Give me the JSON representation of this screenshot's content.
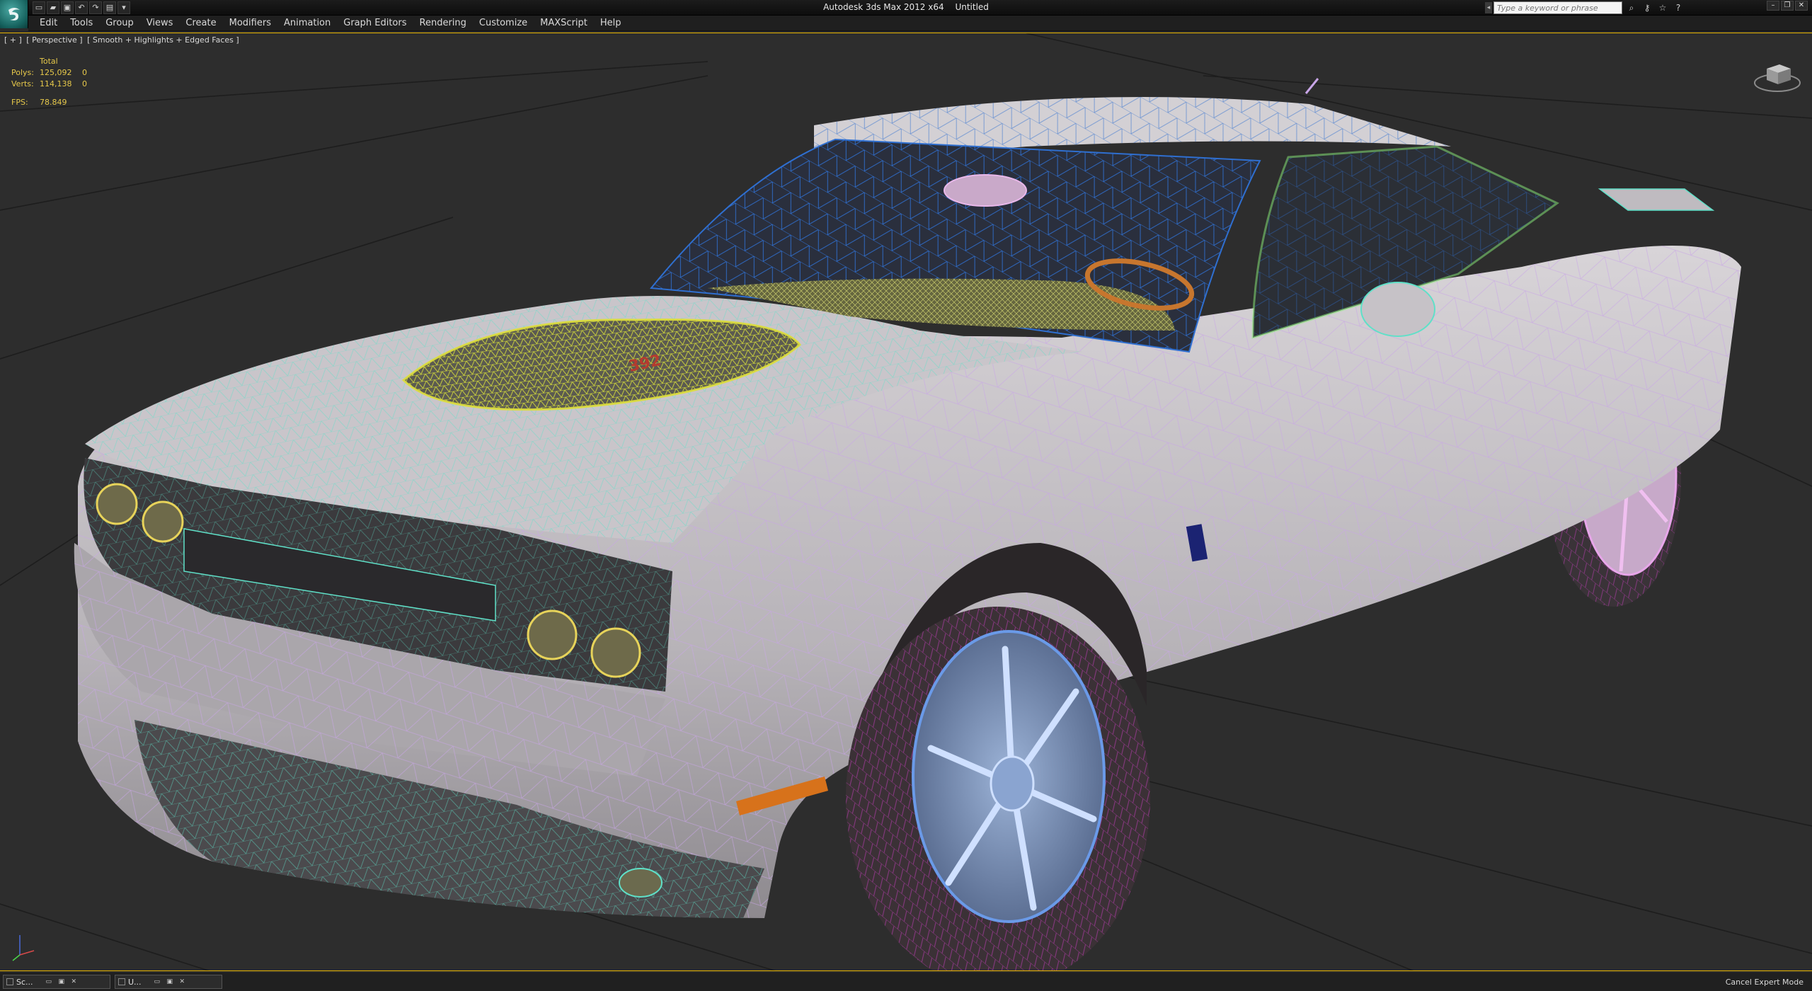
{
  "titlebar": {
    "app_name": "Autodesk 3ds Max  2012 x64",
    "document": "Untitled",
    "search_placeholder": "Type a keyword or phrase",
    "quick_access": [
      "new-icon",
      "open-icon",
      "save-icon",
      "undo-icon",
      "redo-icon",
      "project-icon",
      "dropdown-icon"
    ],
    "info_tools": [
      "binoculars-icon",
      "key-icon",
      "star-icon",
      "help-icon"
    ],
    "window_controls": [
      "minimize-icon",
      "restore-icon",
      "close-icon"
    ]
  },
  "menu": {
    "items": [
      "Edit",
      "Tools",
      "Group",
      "Views",
      "Create",
      "Modifiers",
      "Animation",
      "Graph Editors",
      "Rendering",
      "Customize",
      "MAXScript",
      "Help"
    ]
  },
  "viewport": {
    "label": {
      "plus": "[ + ]",
      "view": "[ Perspective ]",
      "shading": "[ Smooth + Highlights + Edged Faces ]"
    },
    "stats": {
      "header": "Total",
      "polys_label": "Polys:",
      "polys_value": "125,092",
      "polys_sel": "0",
      "verts_label": "Verts:",
      "verts_value": "114,138",
      "verts_sel": "0",
      "fps_label": "FPS:",
      "fps_value": "78.849"
    }
  },
  "bottombar": {
    "windows": [
      {
        "label": "Sc..."
      },
      {
        "label": "U..."
      }
    ],
    "cancel_expert": "Cancel Expert Mode"
  },
  "colors": {
    "viewport_border": "#e6b400",
    "stats_text": "#e6c84a",
    "wire_body": "#c8a7e6",
    "wire_trim": "#5fe0c8",
    "wire_hood": "#d8e23a"
  }
}
